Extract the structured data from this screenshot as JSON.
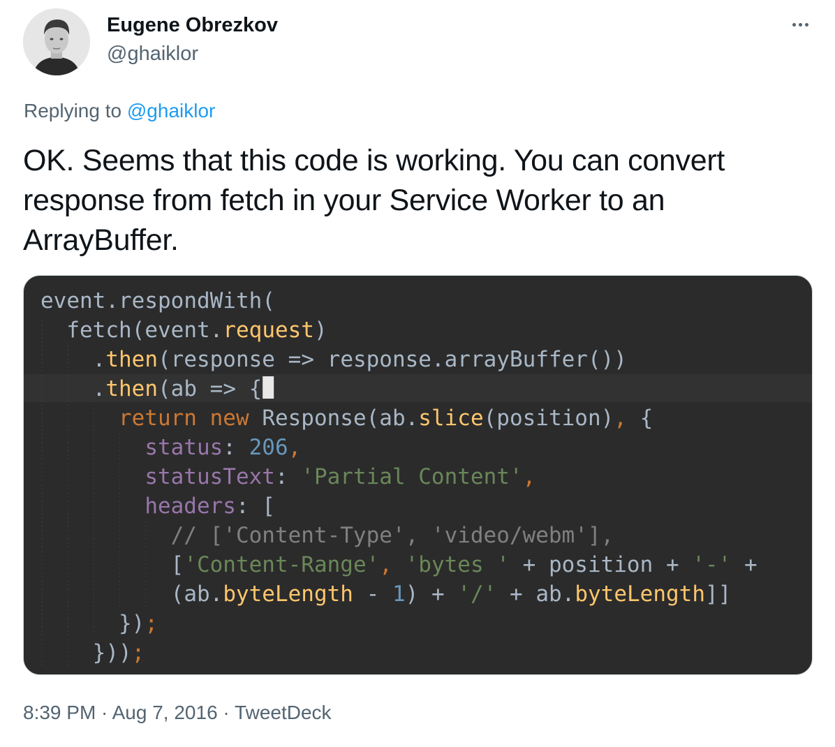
{
  "author": {
    "name": "Eugene Obrezkov",
    "handle": "@ghaiklor"
  },
  "menu_icon": "more-horizontal-icon",
  "reply": {
    "prefix": "Replying to ",
    "mention": "@ghaiklor"
  },
  "tweet_text": "OK. Seems that this code is working. You can convert response from fetch in your Service Worker to an ArrayBuffer.",
  "code_lines": [
    "event.respondWith(",
    "  fetch(event.request)",
    "    .then(response => response.arrayBuffer())",
    "    .then(ab => {",
    "      return new Response(ab.slice(position), {",
    "        status: 206,",
    "        statusText: 'Partial Content',",
    "        headers: [",
    "          // ['Content-Type', 'video/webm'],",
    "          ['Content-Range', 'bytes ' + position + '-' +",
    "          (ab.byteLength - 1) + '/' + ab.byteLength]]",
    "      });",
    "    }));"
  ],
  "colors": {
    "code_background": "#2b2b2b",
    "plain": "#a9b7c6",
    "keyword": "#cc7832",
    "method": "#ffc66d",
    "property": "#9876aa",
    "number": "#6897bb",
    "string": "#6a8759",
    "comment": "#808080",
    "link": "#1d9bf0",
    "muted": "#536471"
  },
  "footer": {
    "time": "8:39 PM",
    "separator": " · ",
    "date": "Aug 7, 2016",
    "source": "TweetDeck"
  }
}
